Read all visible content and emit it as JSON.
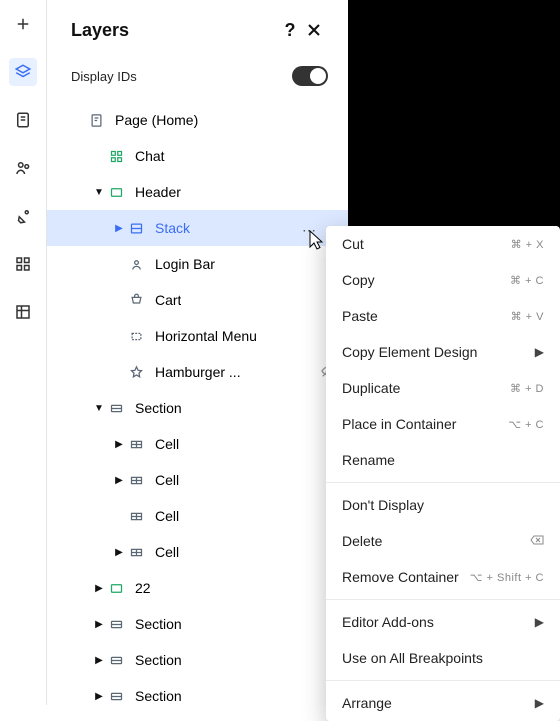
{
  "panel": {
    "title": "Layers",
    "display_ids_label": "Display IDs"
  },
  "tree": [
    {
      "indent": 24,
      "caret": null,
      "icon": "page",
      "iconColor": "#5a6775",
      "label": "Page (Home)",
      "selected": false
    },
    {
      "indent": 44,
      "caret": null,
      "icon": "grid4",
      "iconColor": "#1fa864",
      "label": "Chat",
      "selected": false
    },
    {
      "indent": 44,
      "caret": "down",
      "icon": "container",
      "iconColor": "#1fa864",
      "label": "Header",
      "selected": false
    },
    {
      "indent": 64,
      "caret": "right",
      "icon": "stack",
      "iconColor": "#3b6ef6",
      "label": "Stack",
      "selected": true
    },
    {
      "indent": 64,
      "caret": null,
      "icon": "avatar",
      "iconColor": "#5a6775",
      "label": "Login Bar",
      "selected": false
    },
    {
      "indent": 64,
      "caret": null,
      "icon": "cart",
      "iconColor": "#5a6775",
      "label": "Cart",
      "selected": false
    },
    {
      "indent": 64,
      "caret": null,
      "icon": "dashed",
      "iconColor": "#5a6775",
      "label": "Horizontal Menu",
      "selected": false
    },
    {
      "indent": 64,
      "caret": null,
      "icon": "star",
      "iconColor": "#5a6775",
      "label": "Hamburger ...",
      "selected": false,
      "hidden": true
    },
    {
      "indent": 44,
      "caret": "down",
      "icon": "section",
      "iconColor": "#5a6775",
      "label": "Section",
      "selected": false
    },
    {
      "indent": 64,
      "caret": "right",
      "icon": "cell",
      "iconColor": "#5a6775",
      "label": "Cell",
      "selected": false
    },
    {
      "indent": 64,
      "caret": "right",
      "icon": "cell",
      "iconColor": "#5a6775",
      "label": "Cell",
      "selected": false
    },
    {
      "indent": 64,
      "caret": null,
      "icon": "cell",
      "iconColor": "#5a6775",
      "label": "Cell",
      "selected": false
    },
    {
      "indent": 64,
      "caret": "right",
      "icon": "cell",
      "iconColor": "#5a6775",
      "label": "Cell",
      "selected": false
    },
    {
      "indent": 44,
      "caret": "right",
      "icon": "container",
      "iconColor": "#1fa864",
      "label": "22",
      "selected": false
    },
    {
      "indent": 44,
      "caret": "right",
      "icon": "section",
      "iconColor": "#5a6775",
      "label": "Section",
      "selected": false
    },
    {
      "indent": 44,
      "caret": "right",
      "icon": "section",
      "iconColor": "#5a6775",
      "label": "Section",
      "selected": false
    },
    {
      "indent": 44,
      "caret": "right",
      "icon": "section",
      "iconColor": "#5a6775",
      "label": "Section",
      "selected": false
    }
  ],
  "context_menu": [
    {
      "label": "Cut",
      "shortcut": "⌘ + X"
    },
    {
      "label": "Copy",
      "shortcut": "⌘ + C"
    },
    {
      "label": "Paste",
      "shortcut": "⌘ + V"
    },
    {
      "label": "Copy Element Design",
      "submenu": true
    },
    {
      "label": "Duplicate",
      "shortcut": "⌘ + D"
    },
    {
      "label": "Place in Container",
      "shortcut": "⌥ + C"
    },
    {
      "label": "Rename"
    },
    {
      "sep": true
    },
    {
      "label": "Don't Display"
    },
    {
      "label": "Delete",
      "trailing_icon": "delete-key"
    },
    {
      "label": "Remove Container",
      "shortcut": "⌥ + Shift + C"
    },
    {
      "sep": true
    },
    {
      "label": "Editor Add-ons",
      "submenu": true
    },
    {
      "label": "Use on All Breakpoints"
    },
    {
      "sep": true
    },
    {
      "label": "Arrange",
      "submenu": true
    }
  ]
}
